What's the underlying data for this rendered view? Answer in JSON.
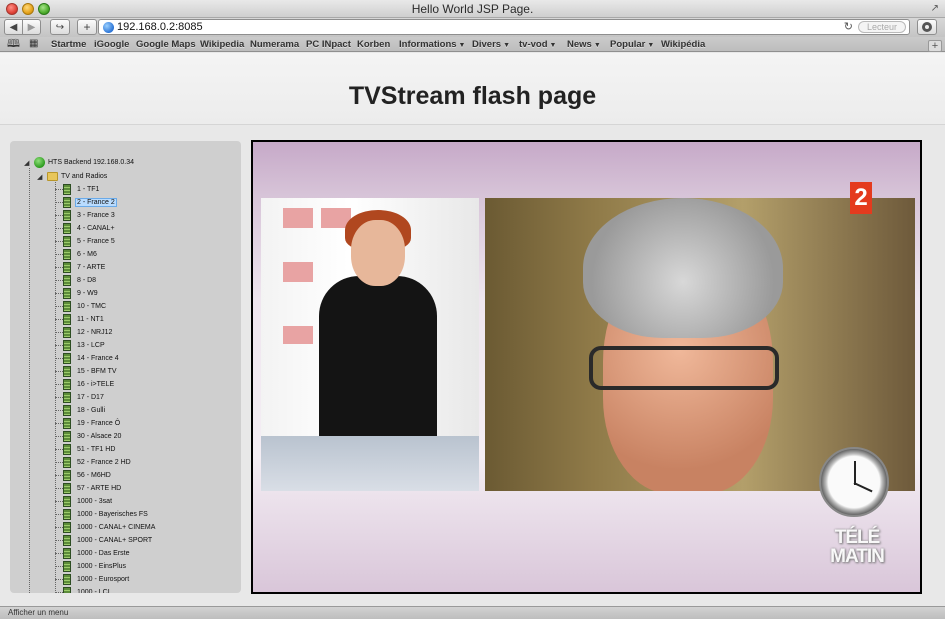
{
  "window": {
    "title": "Hello World JSP Page."
  },
  "toolbar": {
    "url": "192.168.0.2:8085",
    "reader_label": "Lecteur"
  },
  "bookmarks": [
    {
      "label": "Startme",
      "dropdown": false
    },
    {
      "label": "iGoogle",
      "dropdown": false
    },
    {
      "label": "Google Maps",
      "dropdown": false
    },
    {
      "label": "Wikipedia",
      "dropdown": false
    },
    {
      "label": "Numerama",
      "dropdown": false
    },
    {
      "label": "PC INpact",
      "dropdown": false
    },
    {
      "label": "Korben",
      "dropdown": false
    },
    {
      "label": "Informations",
      "dropdown": true
    },
    {
      "label": "Divers",
      "dropdown": true
    },
    {
      "label": "tv-vod",
      "dropdown": true
    },
    {
      "label": "News",
      "dropdown": true
    },
    {
      "label": "Popular",
      "dropdown": true
    },
    {
      "label": "Wikipédia",
      "dropdown": false
    }
  ],
  "page": {
    "title": "TVStream flash page"
  },
  "tree": {
    "root_label": "HTS Backend 192.168.0.34",
    "folder_label": "TV and Radios",
    "selected_index": 1,
    "channels": [
      "1 - TF1",
      "2 - France 2",
      "3 - France 3",
      "4 - CANAL+",
      "5 - France 5",
      "6 - M6",
      "7 - ARTE",
      "8 - D8",
      "9 - W9",
      "10 - TMC",
      "11 - NT1",
      "12 - NRJ12",
      "13 - LCP",
      "14 - France 4",
      "15 - BFM TV",
      "16 - i>TELE",
      "17 - D17",
      "18 - Gulli",
      "19 - France Ô",
      "30 - Alsace 20",
      "51 - TF1 HD",
      "52 - France 2 HD",
      "56 - M6HD",
      "57 - ARTE HD",
      "1000 - 3sat",
      "1000 - Bayerisches FS",
      "1000 - CANAL+ CINEMA",
      "1000 - CANAL+ SPORT",
      "1000 - Das Erste",
      "1000 - EinsPlus",
      "1000 - Eurosport",
      "1000 - LCI"
    ]
  },
  "video": {
    "channel_logo": "2",
    "show_logo_line1": "TÉLÉ",
    "show_logo_line2": "MATIN"
  },
  "status": {
    "text": "Afficher un menu"
  }
}
